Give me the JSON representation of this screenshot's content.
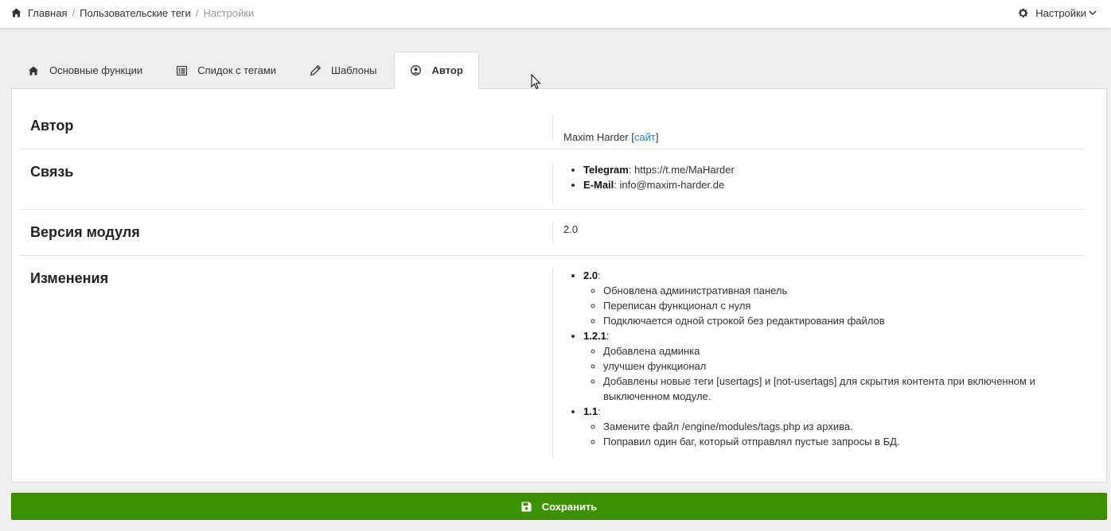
{
  "breadcrumb": {
    "home": "Главная",
    "section": "Пользовательские теги",
    "current": "Настройки",
    "separator": "/"
  },
  "header": {
    "settings_label": "Настройки"
  },
  "tabs": [
    {
      "label": "Основные функции",
      "icon": "home-icon"
    },
    {
      "label": "Спидок с тегами",
      "icon": "list-icon"
    },
    {
      "label": "Шаблоны",
      "icon": "pencil-icon"
    },
    {
      "label": "Автор",
      "icon": "user-circle-icon",
      "active": true
    }
  ],
  "author": {
    "label": "Автор",
    "name": "Maxim Harder",
    "link_open": "[",
    "link_text": "сайт",
    "link_close": "]"
  },
  "contact": {
    "label": "Связь",
    "items": [
      {
        "key": "Telegram",
        "value": ": https://t.me/MaHarder"
      },
      {
        "key": "E-Mail",
        "value": ": info@maxim-harder.de"
      }
    ]
  },
  "version": {
    "label": "Версия модуля",
    "value": "2.0"
  },
  "changes": {
    "label": "Изменения",
    "versions": [
      {
        "version": "2.0",
        "suffix": ":",
        "items": [
          "Обновлена административная панель",
          "Переписан функционал с нуля",
          "Подключается одной строкой без редактирования файлов"
        ]
      },
      {
        "version": "1.2.1",
        "suffix": ":",
        "items": [
          "Добавлена админка",
          "улучшен функционал",
          "Добавлены новые теги [usertags] и [not-usertags] для скрытия контента при включенном и выключенном модуле."
        ]
      },
      {
        "version": "1.1",
        "suffix": ":",
        "items": [
          "Замените файл /engine/modules/tags.php из архива.",
          "Поправил один баг, который отправлял пустые запросы в БД."
        ]
      }
    ]
  },
  "save_button": {
    "label": "Сохранить",
    "icon": "floppy-disk-icon"
  },
  "colors": {
    "save_bg": "#3c9103",
    "link": "#2f7ec1",
    "page_bg": "#eeeeee"
  }
}
